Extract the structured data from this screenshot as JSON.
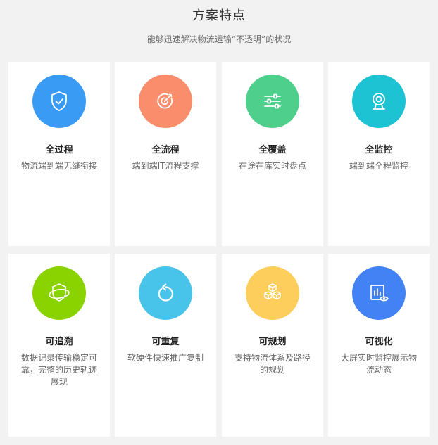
{
  "header": {
    "title": "方案特点",
    "subtitle": "能够迅速解决物流运输“不透明”的状况"
  },
  "cards": [
    {
      "title": "全过程",
      "desc": "物流端到端无缝衔接",
      "color": "#3a9bf4",
      "icon": "shield-check-icon"
    },
    {
      "title": "全流程",
      "desc": "端到端IT流程支撑",
      "color": "#f98d6c",
      "icon": "target-icon"
    },
    {
      "title": "全覆盖",
      "desc": "在途在库实时盘点",
      "color": "#4fcf8c",
      "icon": "sliders-icon"
    },
    {
      "title": "全监控",
      "desc": "端到端全程监控",
      "color": "#1ec3d3",
      "icon": "webcam-icon"
    },
    {
      "title": "可追溯",
      "desc": "数据记录传输稳定可靠，完整的历史轨迹展现",
      "color": "#8ad200",
      "icon": "shield-orbit-icon"
    },
    {
      "title": "可重复",
      "desc": "软硬件快速推广复制",
      "color": "#48c3ea",
      "icon": "refresh-icon"
    },
    {
      "title": "可规划",
      "desc": "支持物流体系及路径的规划",
      "color": "#fdce5c",
      "icon": "cubes-icon"
    },
    {
      "title": "可视化",
      "desc": "大屏实时监控展示物流动态",
      "color": "#4282f4",
      "icon": "chart-eye-icon"
    }
  ]
}
